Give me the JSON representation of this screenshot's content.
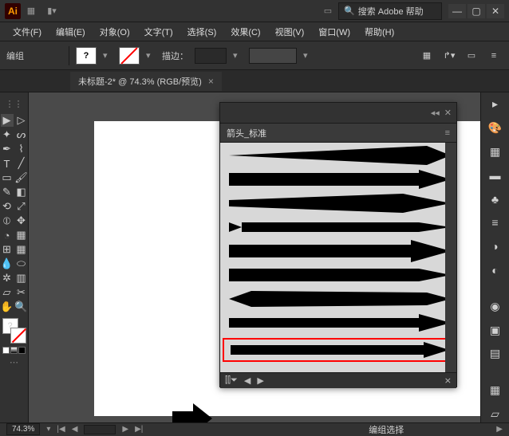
{
  "titlebar": {
    "logo": "Ai",
    "search_placeholder": "搜索 Adobe 帮助"
  },
  "menu": {
    "file": "文件(F)",
    "edit": "编辑(E)",
    "object": "对象(O)",
    "type": "文字(T)",
    "select": "选择(S)",
    "effect": "效果(C)",
    "view": "视图(V)",
    "window": "窗口(W)",
    "help": "帮助(H)"
  },
  "controlbar": {
    "group_label": "编组",
    "stroke_label": "描边："
  },
  "document": {
    "tab_title": "未标题-2* @ 74.3% (RGB/预览)"
  },
  "symbols_panel": {
    "title": "箭头_标准"
  },
  "statusbar": {
    "zoom": "74.3%",
    "selection_label": "编组选择"
  },
  "fill_swatch_mark": "?"
}
